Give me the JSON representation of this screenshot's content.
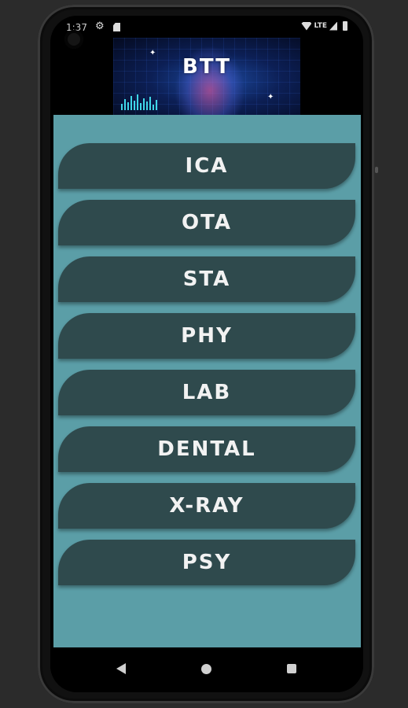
{
  "status_bar": {
    "time": "1:37",
    "network": "LTE"
  },
  "banner": {
    "title": "BTT"
  },
  "menu": {
    "items": [
      {
        "label": "ICA"
      },
      {
        "label": "OTA"
      },
      {
        "label": "STA"
      },
      {
        "label": "PHY"
      },
      {
        "label": "LAB"
      },
      {
        "label": "DENTAL"
      },
      {
        "label": "X-RAY"
      },
      {
        "label": "PSY"
      }
    ]
  },
  "colors": {
    "background": "#5b9ea7",
    "button": "#2f4a4d",
    "button_text": "#f2f2f2"
  },
  "icons": {
    "status": [
      "gear-icon",
      "sd-card-icon",
      "wifi-icon",
      "signal-icon",
      "battery-icon"
    ],
    "navigation": [
      "back-icon",
      "home-icon",
      "recents-icon"
    ]
  }
}
